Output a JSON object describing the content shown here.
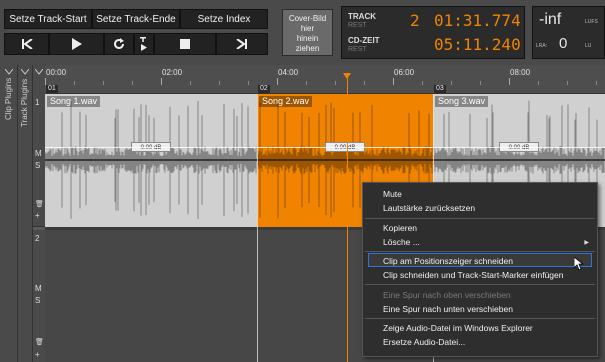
{
  "toolbar": {
    "set_track_start": "Setze Track-Start",
    "set_track_end": "Setze Track-Ende",
    "set_index": "Setze Index",
    "cover_image": "Cover-Bild\nhier\nhinein\nziehen"
  },
  "display": {
    "track_label": "TRACK",
    "track_sub": "REST",
    "track_number": "2",
    "track_time": "01:31.774",
    "cd_label": "CD-ZEIT",
    "cd_sub": "REST",
    "cd_time": "05:11.240"
  },
  "loudness": {
    "value_top": "-inf",
    "unit_top": "LUFS",
    "lra_label": "LRA:",
    "value_bottom": "0",
    "unit_bottom": "LU"
  },
  "sidebar": {
    "clip_plugins": "Clip Plugins",
    "track_plugins": "Track Plugins"
  },
  "ruler": {
    "labels": [
      "00:00",
      "02:00",
      "04:00",
      "06:00",
      "08:00"
    ],
    "markers": [
      "01",
      "02",
      "03"
    ]
  },
  "tracks": [
    {
      "number": "1",
      "m": "M",
      "s": "S"
    },
    {
      "number": "2",
      "m": "M",
      "s": "S"
    }
  ],
  "clips": [
    {
      "name": "Song 1.wav",
      "gain": "0.00 dB"
    },
    {
      "name": "Song 2.wav",
      "gain": "0.00 dB"
    },
    {
      "name": "Song 3.wav",
      "gain": "0.00 dB"
    }
  ],
  "menu": {
    "mute": "Mute",
    "reset_volume": "Lautstärke zurücksetzen",
    "copy": "Kopieren",
    "delete": "Lösche ...",
    "cut_at_position": "Clip am Positionszeiger schneiden",
    "cut_and_insert": "Clip schneiden und Track-Start-Marker einfügen",
    "move_up": "Eine Spur nach oben verschieben",
    "move_down": "Eine Spur nach unten verschieben",
    "show_explorer": "Zeige Audio-Datei im Windows Explorer",
    "replace_audio": "Ersetze Audio-Datei..."
  },
  "colors": {
    "accent": "#f08400",
    "clip_gray": "#d0d0d0",
    "highlight_border": "#2d73d8"
  }
}
